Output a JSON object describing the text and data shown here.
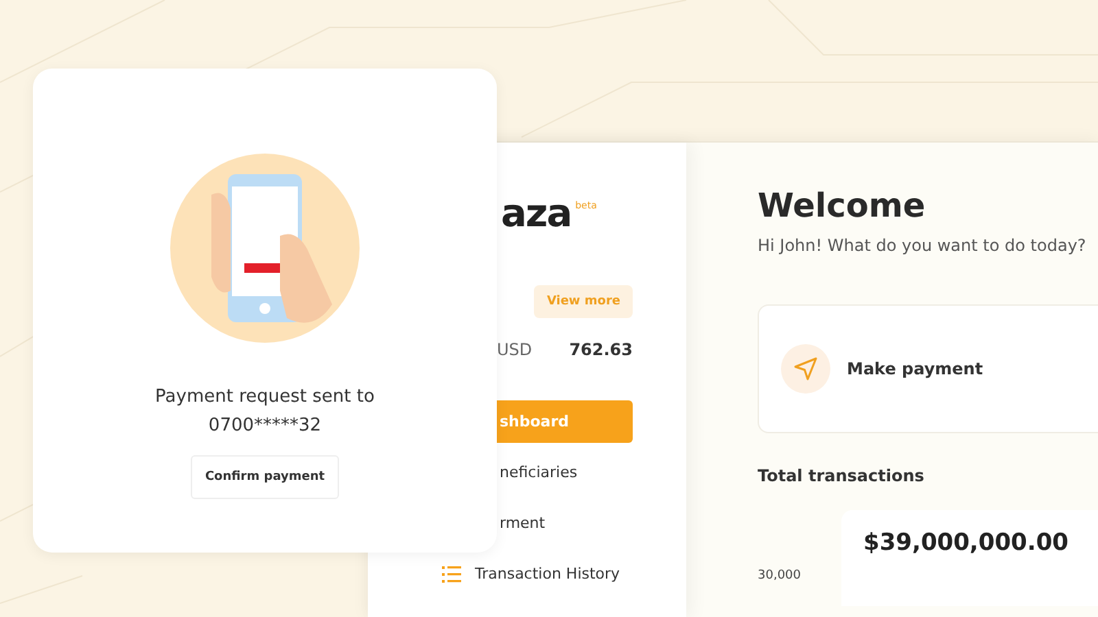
{
  "dashboard": {
    "logo": "aza",
    "logo_badge": "beta",
    "balance": {
      "button": "View more",
      "currency": "USD",
      "amount": "762.63"
    },
    "nav": [
      {
        "label": "shboard",
        "selected": true,
        "kind": "plain"
      },
      {
        "label": "neficiaries",
        "selected": false,
        "kind": "plain"
      },
      {
        "label": "rment",
        "selected": false,
        "kind": "plain"
      },
      {
        "label": "Transaction History",
        "selected": false,
        "kind": "icon"
      }
    ],
    "main": {
      "title": "Welcome",
      "subtitle": "Hi John! What do you want to do today?",
      "action": "Make payment",
      "section": "Total transactions",
      "axis_label": "30,000",
      "total": "$39,000,000.00"
    }
  },
  "modal": {
    "message": "Payment request sent to",
    "phone": "0700*****32",
    "button": "Confirm payment"
  }
}
